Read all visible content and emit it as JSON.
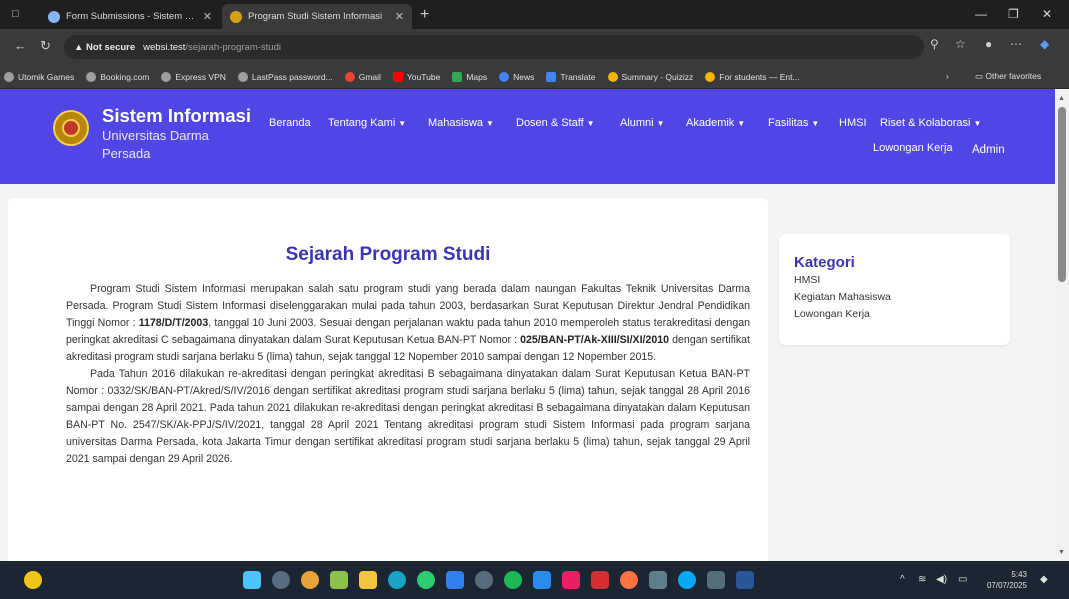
{
  "browser": {
    "tabs": [
      {
        "title": "Form Submissions - Sistem Inform",
        "active": false
      },
      {
        "title": "Program Studi Sistem Informasi",
        "active": true
      }
    ],
    "new_tab_label": "+",
    "address": {
      "security": "Not secure",
      "host": "websi.test",
      "path": "/sejarah-program-studi"
    },
    "bookmarks": [
      "Utomik Games",
      "Booking.com",
      "Express VPN",
      "LastPass password...",
      "Gmail",
      "YouTube",
      "Maps",
      "News",
      "Translate",
      "Summary - Quizizz",
      "For students — Ent..."
    ],
    "other_favorites": "Other favorites"
  },
  "site": {
    "brand_title": "Sistem Informasi",
    "brand_sub": "Universitas Darma Persada",
    "menu": [
      {
        "label": "Beranda",
        "dropdown": false
      },
      {
        "label": "Tentang Kami",
        "dropdown": true
      },
      {
        "label": "Mahasiswa",
        "dropdown": true
      },
      {
        "label": "Dosen & Staff",
        "dropdown": true
      },
      {
        "label": "Alumni",
        "dropdown": true
      },
      {
        "label": "Akademik",
        "dropdown": true
      },
      {
        "label": "Fasilitas",
        "dropdown": true
      },
      {
        "label": "HMSI",
        "dropdown": false
      },
      {
        "label": "Riset & Kolaborasi",
        "dropdown": true
      }
    ],
    "menu_row2": [
      "Lowongan Kerja",
      "Admin"
    ],
    "colors": {
      "nav": "#5046e5",
      "title": "#3b35b3"
    }
  },
  "article": {
    "title": "Sejarah Program Studi",
    "p1": {
      "t1": "Program Studi Sistem Informasi merupakan salah satu program studi yang berada dalam naungan Fakultas Teknik Universitas Darma Persada. Program Studi Sistem Informasi diselenggarakan mulai pada tahun 2003, berdasarkan Surat Keputusan Direktur Jendral Pendidikan Tinggi Nomor : ",
      "b1": "1178/D/T/2003",
      "t2": ", tanggal 10 Juni 2003. Sesuai dengan perjalanan waktu pada tahun 2010 memperoleh status terakreditasi dengan peringkat akreditasi C sebagaimana dinyatakan dalam Surat Keputusan Ketua BAN-PT Nomor : ",
      "b2": "025/BAN-PT/Ak-XIII/SI/XI/2010",
      "t3": " dengan sertifikat akreditasi program studi sarjana berlaku 5 (lima) tahun, sejak tanggal 12 Nopember 2010 sampai dengan 12 Nopember 2015."
    },
    "p2": "Pada Tahun 2016 dilakukan re-akreditasi dengan peringkat akreditasi B sebagaimana dinyatakan dalam Surat Keputusan Ketua BAN-PT Nomor : 0332/SK/BAN-PT/Akred/S/IV/2016 dengan sertifikat akreditasi program studi sarjana berlaku 5 (lima) tahun, sejak tanggal 28 April 2016 sampai dengan 28 April 2021. Pada tahun 2021 dilakukan re-akreditasi dengan peringkat akreditasi B sebagaimana dinyatakan dalam Keputusan BAN-PT No. 2547/SK/Ak-PPJ/S/IV/2021, tanggal 28 April 2021 Tentang akreditasi program studi Sistem Informasi pada program sarjana universitas Darma Persada, kota Jakarta Timur dengan sertifikat akreditasi program studi sarjana berlaku 5 (lima) tahun, sejak tanggal 29 April 2021 sampai dengan 29 April 2026."
  },
  "sidebar": {
    "title": "Kategori",
    "items": [
      "HMSI",
      "Kegiatan Mahasiswa",
      "Lowongan Kerja"
    ]
  },
  "taskbar": {
    "time": "5:43",
    "date": "07/07/2025"
  }
}
